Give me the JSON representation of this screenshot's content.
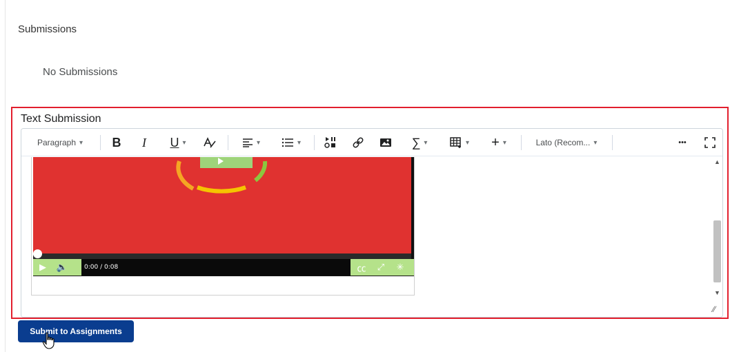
{
  "page": {
    "submissions_heading": "Submissions",
    "no_submissions_text": "No Submissions",
    "text_submission_label": "Text Submission",
    "submit_button_label": "Submit to Assignments"
  },
  "toolbar": {
    "paragraph_label": "Paragraph",
    "bold_glyph": "B",
    "italic_glyph": "I",
    "underline_glyph": "U",
    "font_label": "Lato (Recom...",
    "more_glyph": "•••"
  },
  "video": {
    "time_text": "0:00  / 0:08",
    "colors": {
      "frame_red": "#e03230",
      "controls_green": "#b5e28a"
    }
  },
  "colors": {
    "highlight_red": "#e21e2d",
    "button_blue": "#0a3d8f"
  },
  "icons": [
    "chevron-down-icon",
    "bold-icon",
    "italic-icon",
    "underline-icon",
    "text-style-icon",
    "align-icon",
    "list-icon",
    "media-icon",
    "link-icon",
    "image-icon",
    "equation-icon",
    "table-icon",
    "insert-plus-icon",
    "more-icon",
    "fullscreen-icon",
    "play-icon",
    "volume-icon",
    "captions-icon",
    "expand-icon",
    "loading-icon",
    "hand-cursor-icon"
  ]
}
